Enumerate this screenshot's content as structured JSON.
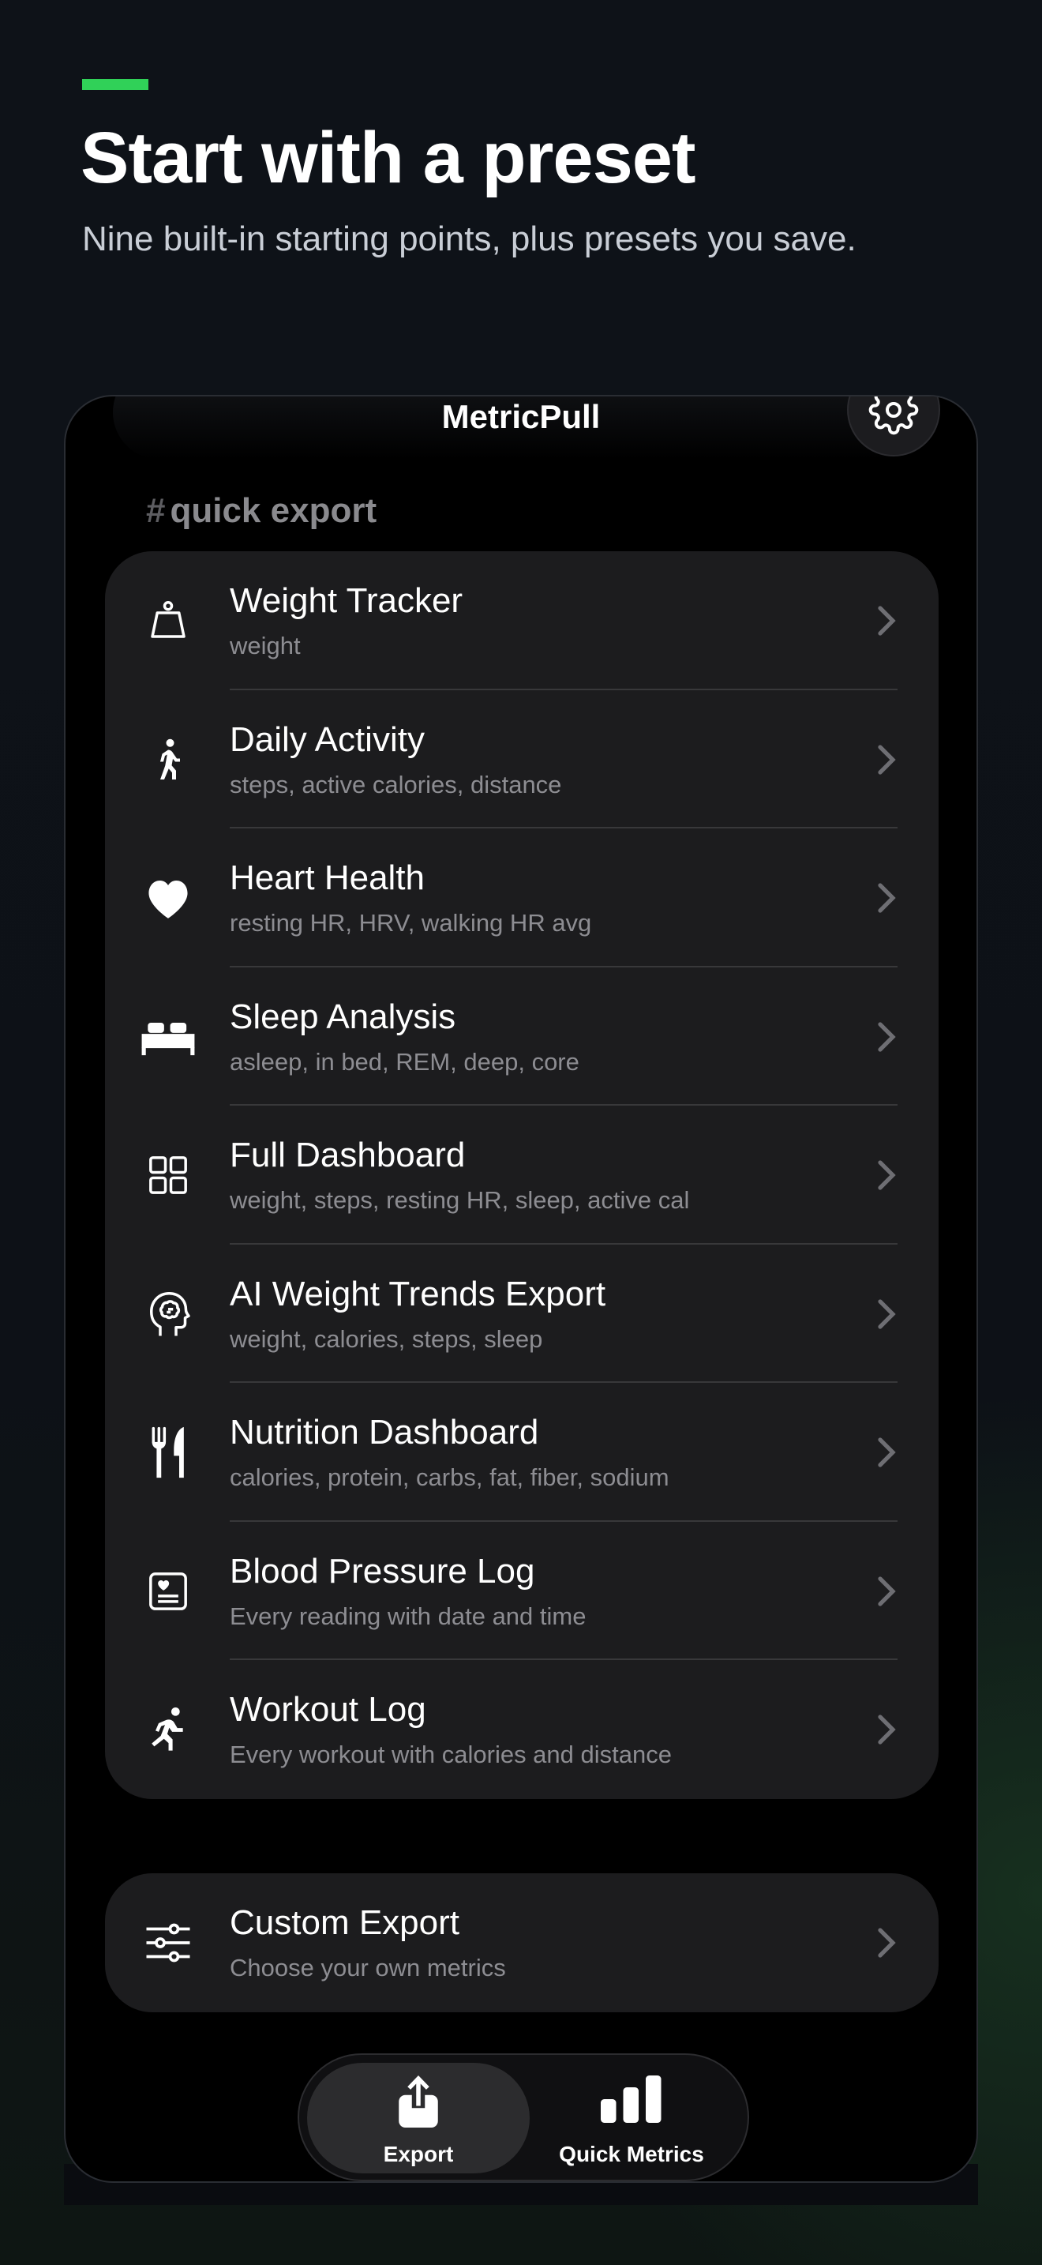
{
  "theme": {
    "accent": "#30d158",
    "background": "#0d1117",
    "card": "#1c1c1e"
  },
  "hero": {
    "title": "Start with a preset",
    "subtitle": "Nine built-in starting points, plus presets you save."
  },
  "app": {
    "title": "MetricPull",
    "settings_icon": "gear-icon",
    "section_label": "quick export",
    "section_prefix": "#"
  },
  "presets": [
    {
      "name": "Weight Tracker",
      "metrics": "weight",
      "icon": "scale-icon"
    },
    {
      "name": "Daily Activity",
      "metrics": "steps, active calories, distance",
      "icon": "walking-icon"
    },
    {
      "name": "Heart Health",
      "metrics": "resting HR, HRV, walking HR avg",
      "icon": "heart-icon"
    },
    {
      "name": "Sleep Analysis",
      "metrics": "asleep, in bed, REM, deep, core",
      "icon": "bed-icon"
    },
    {
      "name": "Full Dashboard",
      "metrics": "weight, steps, resting HR, sleep, active cal",
      "icon": "grid-icon"
    },
    {
      "name": "AI Weight Trends Export",
      "metrics": "weight, calories, steps, sleep",
      "icon": "brain-head-icon"
    },
    {
      "name": "Nutrition Dashboard",
      "metrics": "calories, protein, carbs, fat, fiber, sodium",
      "icon": "fork-knife-icon"
    },
    {
      "name": "Blood Pressure Log",
      "metrics": "Every reading with date and time",
      "icon": "heart-card-icon"
    },
    {
      "name": "Workout Log",
      "metrics": "Every workout with calories and distance",
      "icon": "running-icon"
    }
  ],
  "custom": {
    "name": "Custom Export",
    "metrics": "Choose your own metrics",
    "icon": "sliders-icon"
  },
  "tabs": [
    {
      "label": "Export",
      "icon": "export-icon",
      "selected": true
    },
    {
      "label": "Quick Metrics",
      "icon": "bar-chart-icon",
      "selected": false
    }
  ]
}
